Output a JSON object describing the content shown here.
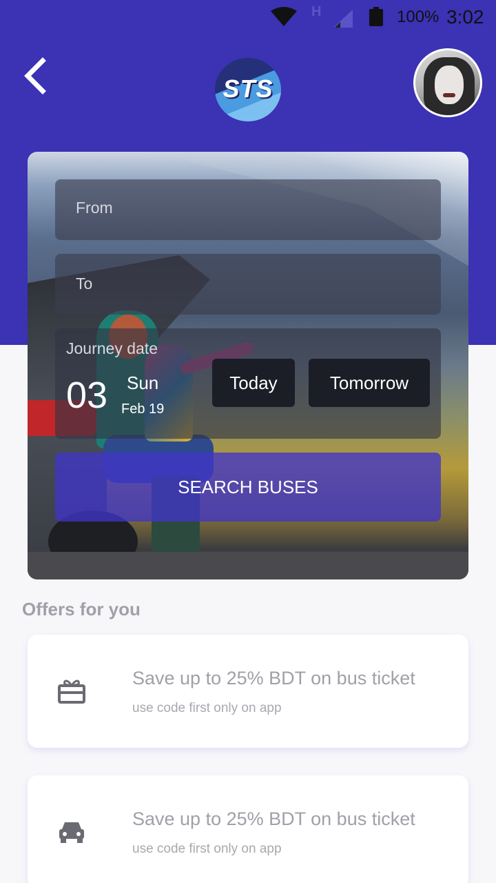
{
  "status_bar": {
    "network_indicator": "H",
    "battery_percent": "100%",
    "time": "3:02"
  },
  "header": {
    "logo_text": "STS",
    "back_icon": "chevron-left-icon",
    "avatar_icon": "user-avatar"
  },
  "search_form": {
    "from_placeholder": "From",
    "to_placeholder": "To",
    "journey_date_label": "Journey date",
    "date": {
      "day": "03",
      "weekday": "Sun",
      "month_day": "Feb 19"
    },
    "today_label": "Today",
    "tomorrow_label": "Tomorrow",
    "search_label": "SEARCH BUSES"
  },
  "offers": {
    "title": "Offers for you",
    "items": [
      {
        "icon": "gift-icon",
        "title": "Save up to 25% BDT on bus ticket",
        "subtitle": "use code first only on app"
      },
      {
        "icon": "car-icon",
        "title": "Save up to 25% BDT on bus ticket",
        "subtitle": "use code first only on app"
      }
    ]
  },
  "colors": {
    "primary": "#3b32b4",
    "background": "#f7f7fa",
    "text_muted": "#a0a0a8"
  }
}
